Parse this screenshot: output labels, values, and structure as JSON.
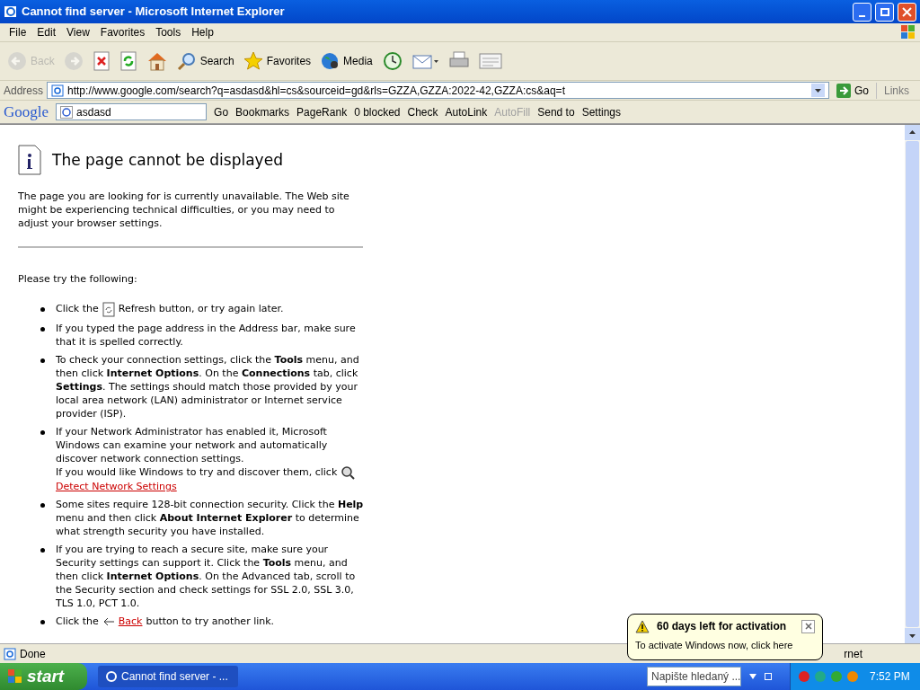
{
  "window": {
    "title": "Cannot find server - Microsoft Internet Explorer"
  },
  "menu": [
    "File",
    "Edit",
    "View",
    "Favorites",
    "Tools",
    "Help"
  ],
  "toolbar": [
    {
      "label": "Back",
      "kind": "back",
      "disabled": true
    },
    {
      "kind": "forward",
      "disabled": true
    },
    {
      "kind": "stop",
      "disabled": false
    },
    {
      "kind": "refresh",
      "disabled": false
    },
    {
      "kind": "home",
      "disabled": false
    },
    {
      "label": "Search",
      "kind": "search",
      "disabled": false
    },
    {
      "label": "Favorites",
      "kind": "favorites",
      "disabled": false
    },
    {
      "label": "Media",
      "kind": "media",
      "disabled": false
    },
    {
      "kind": "history",
      "disabled": false
    },
    {
      "kind": "mail",
      "disabled": false
    },
    {
      "kind": "print",
      "disabled": false
    },
    {
      "kind": "edit",
      "disabled": false
    }
  ],
  "address": {
    "label": "Address",
    "value": "http://www.google.com/search?q=asdasd&hl=cs&sourceid=gd&rls=GZZA,GZZA:2022-42,GZZA:cs&aq=t",
    "go": "Go",
    "links": "Links"
  },
  "google_toolbar": {
    "logo": "Google",
    "query": "asdasd",
    "go": "Go",
    "items": [
      {
        "label": "Bookmarks",
        "disabled": false
      },
      {
        "label": "PageRank",
        "disabled": false
      },
      {
        "label": "0 blocked",
        "disabled": false
      },
      {
        "label": "Check",
        "disabled": false
      },
      {
        "label": "AutoLink",
        "disabled": false
      },
      {
        "label": "AutoFill",
        "disabled": true
      },
      {
        "label": "Send to",
        "disabled": false
      },
      {
        "label": "Settings",
        "disabled": false
      }
    ]
  },
  "page": {
    "heading": "The page cannot be displayed",
    "intro": "The page you are looking for is currently unavailable. The Web site might be experiencing technical difficulties, or you may need to adjust your browser settings.",
    "try": "Please try the following:",
    "bullets": [
      {
        "kind": "refresh",
        "before": "Click the",
        "after": "Refresh button, or try again later."
      },
      {
        "kind": "text",
        "text": "If you typed the page address in the Address bar, make sure that it is spelled correctly."
      },
      {
        "kind": "text",
        "text": "To check your connection settings, click the **Tools** menu, and then click **Internet Options**. On the **Connections** tab, click **Settings**. The settings should match those provided by your local area network (LAN) administrator or Internet service provider (ISP)."
      },
      {
        "kind": "detect",
        "text": "If your Network Administrator has enabled it, Microsoft Windows can examine your network and automatically discover network connection settings.",
        "before": "If you would like Windows to try and discover them, click",
        "link": "Detect Network Settings"
      },
      {
        "kind": "text",
        "text": "Some sites require 128-bit connection security. Click the **Help** menu and then click **About Internet Explorer** to determine what strength security you have installed."
      },
      {
        "kind": "text",
        "text": "If you are trying to reach a secure site, make sure your Security settings can support it. Click the **Tools** menu, and then click **Internet Options**. On the Advanced tab, scroll to the Security section and check settings for SSL 2.0, SSL 3.0, TLS 1.0, PCT 1.0."
      },
      {
        "kind": "back",
        "before": "Click the",
        "link": "Back",
        "after": "button to try another link."
      }
    ]
  },
  "status": {
    "text": "Done",
    "zone": "rnet"
  },
  "balloon": {
    "title": "60 days left for activation",
    "text": "To activate Windows now, click here"
  },
  "taskbar": {
    "start": "start",
    "task": "Cannot find server - ...",
    "search_placeholder": "Napište hledaný ...",
    "time": "7:52 PM"
  }
}
